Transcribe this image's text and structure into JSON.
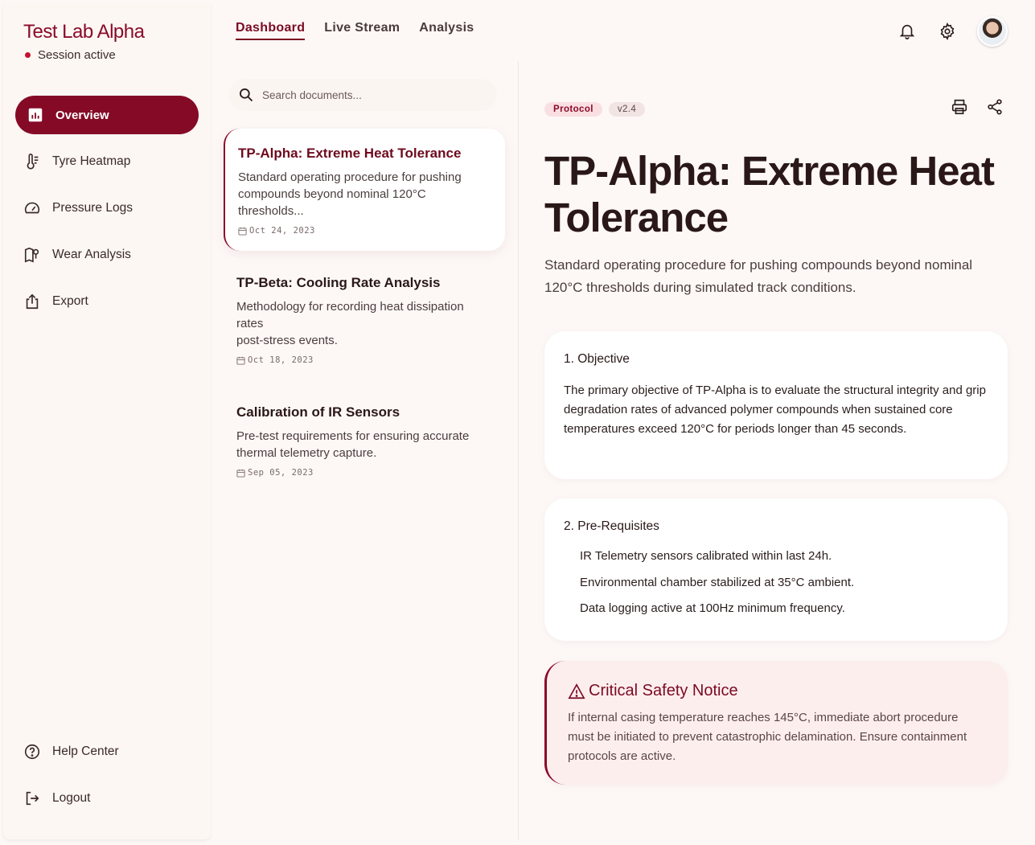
{
  "brand": {
    "title": "Test Lab Alpha",
    "session": "Session active"
  },
  "sidebar": {
    "items": [
      {
        "label": "Overview",
        "icon": "bar-chart-icon",
        "active": true
      },
      {
        "label": "Tyre Heatmap",
        "icon": "thermometer-icon"
      },
      {
        "label": "Pressure Logs",
        "icon": "gauge-icon"
      },
      {
        "label": "Wear Analysis",
        "icon": "map-pin-icon"
      },
      {
        "label": "Export",
        "icon": "share-export-icon"
      }
    ],
    "footer": [
      {
        "label": "Help Center",
        "icon": "help-icon"
      },
      {
        "label": "Logout",
        "icon": "logout-icon"
      }
    ]
  },
  "topnav": {
    "tabs": [
      "Dashboard",
      "Live Stream",
      "Analysis"
    ],
    "active": "Dashboard"
  },
  "search": {
    "placeholder": "Search documents..."
  },
  "documents": [
    {
      "title": "TP-Alpha: Extreme Heat Tolerance",
      "desc": "Standard operating procedure for pushing compounds beyond nominal 120°C thresholds...",
      "date": "Oct 24, 2023",
      "selected": true
    },
    {
      "title": "TP-Beta: Cooling Rate Analysis",
      "desc_lines": [
        "Methodology for recording heat dissipation rates",
        "post-stress events."
      ],
      "date": "Oct 18, 2023"
    },
    {
      "title": "Calibration of IR Sensors",
      "desc": "Pre-test requirements for ensuring accurate thermal telemetry capture.",
      "date": "Sep 05, 2023"
    }
  ],
  "detail": {
    "tags": [
      "Protocol",
      "v2.4"
    ],
    "title": "TP-Alpha: Extreme Heat Tolerance",
    "description": "Standard operating procedure for pushing compounds beyond nominal 120°C thresholds during simulated track conditions.",
    "objective": {
      "heading": "1. Objective",
      "body": "The primary objective of TP-Alpha is to evaluate the structural integrity and grip degradation rates of advanced polymer compounds when sustained core temperatures exceed 120°C for periods longer than 45 seconds."
    },
    "prerequisites": {
      "heading": "2. Pre-Requisites",
      "items": [
        "IR Telemetry sensors calibrated within last 24h.",
        "Environmental chamber stabilized at 35°C ambient.",
        "Data logging active at 100Hz minimum frequency."
      ]
    },
    "notice": {
      "title": "Critical Safety Notice",
      "body": "If internal casing temperature reaches 145°C, immediate abort procedure must be initiated to prevent catastrophic delamination. Ensure containment protocols are active."
    }
  },
  "colors": {
    "accent": "#850a26",
    "background": "#fdf8f6",
    "notice_bg": "#fdeeee"
  }
}
